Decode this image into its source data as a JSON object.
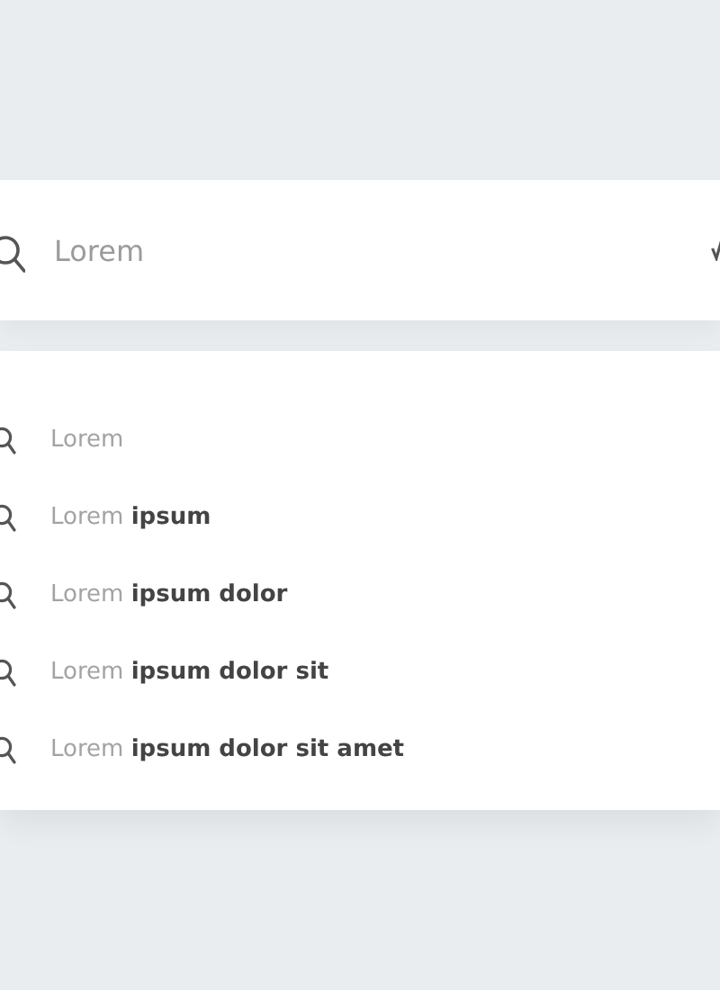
{
  "search": {
    "placeholder": "Lorem"
  },
  "suggestions": [
    {
      "typed": "Lorem"
    },
    {
      "typed": "Lorem",
      "completion": "ipsum"
    },
    {
      "typed": "Lorem",
      "completion": "ipsum dolor"
    },
    {
      "typed": "Lorem",
      "completion": "ipsum dolor sit"
    },
    {
      "typed": "Lorem",
      "completion": "ipsum dolor sit amet"
    }
  ]
}
